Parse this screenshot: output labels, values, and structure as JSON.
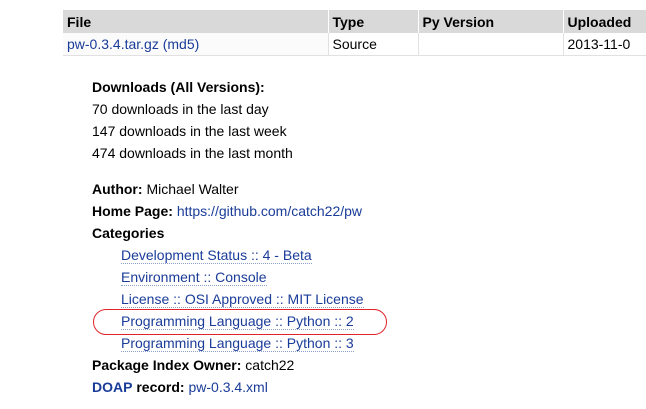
{
  "files_table": {
    "headers": [
      "File",
      "Type",
      "Py Version",
      "Uploaded"
    ],
    "rows": [
      {
        "file": "pw-0.3.4.tar.gz",
        "md5": "(md5)",
        "type": "Source",
        "py_version": "",
        "uploaded": "2013-11-0"
      }
    ]
  },
  "downloads": {
    "title": "Downloads (All Versions):",
    "lines": [
      "70 downloads in the last day",
      "147 downloads in the last week",
      "474 downloads in the last month"
    ]
  },
  "author": {
    "label": "Author:",
    "value": "Michael Walter"
  },
  "home_page": {
    "label": "Home Page:",
    "url": "https://github.com/catch22/pw"
  },
  "categories": {
    "label": "Categories",
    "items": [
      "Development Status :: 4 - Beta",
      "Environment :: Console",
      "License :: OSI Approved :: MIT License",
      "Programming Language :: Python :: 2",
      "Programming Language :: Python :: 3"
    ]
  },
  "owner": {
    "label": "Package Index Owner:",
    "value": "catch22"
  },
  "doap": {
    "link_label": "DOAP",
    "label": "record:",
    "file": "pw-0.3.4.xml"
  },
  "colors": {
    "link": "#1a3c99",
    "header_bg": "#d9d9d9",
    "annotation": "#e0242a"
  }
}
